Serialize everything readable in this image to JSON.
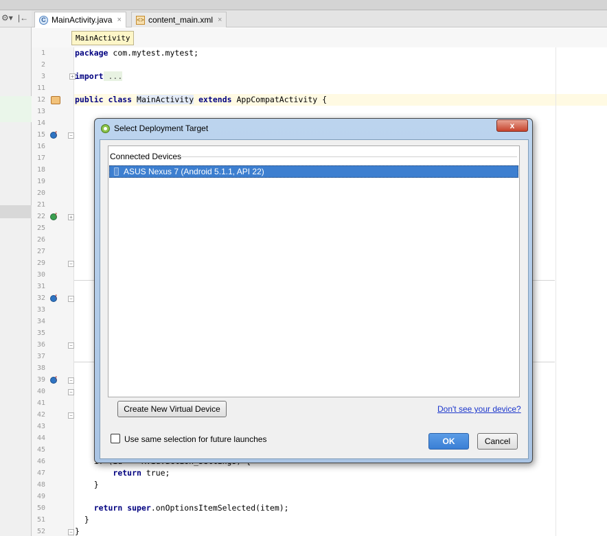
{
  "tabs": [
    {
      "label": "MainActivity.java",
      "icon": "class-icon",
      "close": "×",
      "active": true
    },
    {
      "label": "content_main.xml",
      "icon": "xml-file-icon",
      "close": "×",
      "active": false
    }
  ],
  "breadcrumb": {
    "label": "MainActivity"
  },
  "editor": {
    "line_numbers": [
      "1",
      "2",
      "3",
      "11",
      "12",
      "13",
      "14",
      "15",
      "16",
      "17",
      "18",
      "19",
      "20",
      "21",
      "22",
      "25",
      "26",
      "27",
      "29",
      "30",
      "31",
      "32",
      "33",
      "34",
      "35",
      "36",
      "37",
      "38",
      "39",
      "40",
      "41",
      "42",
      "43",
      "44",
      "45",
      "46",
      "47",
      "48",
      "49",
      "50",
      "51",
      "52"
    ],
    "code": {
      "l1_kw": "package",
      "l1_rest": " com.mytest.mytest;",
      "l3_kw": "import",
      "l3_rest": " ...",
      "l12_kw1": "public",
      "l12_kw2": "class",
      "l12_cls": "MainActivity",
      "l12_kw3": "extends",
      "l12_rest": " AppCompatActivity {",
      "l46": "    if (id == R.id.action_settings) {",
      "l47_kw": "return",
      "l47_rest": " true;",
      "l48": "    }",
      "l50_kw": "return",
      "l50_kw2": "super",
      "l50_rest": ".onOptionsItemSelected(item);",
      "l51": "}",
      "l52": "}"
    }
  },
  "dialog": {
    "title": "Select Deployment Target",
    "close_label": "x",
    "section_header": "Connected Devices",
    "devices": [
      {
        "label": "ASUS Nexus 7 (Android 5.1.1, API 22)",
        "selected": true
      }
    ],
    "create_button": "Create New Virtual Device",
    "help_link": "Don't see your device?",
    "checkbox_label": "Use same selection for future launches",
    "checkbox_checked": false,
    "ok_button": "OK",
    "cancel_button": "Cancel"
  },
  "colors": {
    "selection": "#3d7fd0",
    "keyword": "#000080",
    "ok_button": "#3a7fd5"
  }
}
